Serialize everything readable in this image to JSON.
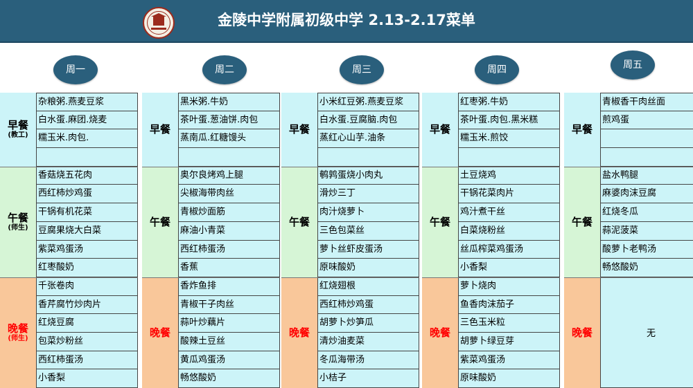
{
  "header": {
    "title": "金陵中学附属初级中学 2.13-2.17菜单"
  },
  "meals": {
    "breakfast": "早餐",
    "lunch": "午餐",
    "dinner": "晚餐",
    "breakfast_note": "(教工)",
    "lunch_note": "(师生)",
    "dinner_note": "(师生)"
  },
  "days": [
    {
      "name": "周一",
      "breakfast": [
        "杂粮粥.燕麦豆浆",
        "白水蛋.麻团.烧麦",
        "糯玉米.肉包.",
        ""
      ],
      "lunch": [
        "香菇烧五花肉",
        "西红柿炒鸡蛋",
        "干锅有机花菜",
        "豆腐果烧大白菜",
        "紫菜鸡蛋汤",
        "红枣酸奶"
      ],
      "dinner": [
        "千张卷肉",
        "香芹腐竹炒肉片",
        "红烧豆腐",
        "包菜炒粉丝",
        "西红柿蛋汤",
        "小香梨"
      ]
    },
    {
      "name": "周二",
      "breakfast": [
        "黑米粥.牛奶",
        "茶叶蛋.葱油饼.肉包",
        "蒸南瓜.红糖馒头",
        ""
      ],
      "lunch": [
        "奥尔良烤鸡上腿",
        "尖椒海带肉丝",
        "青椒炒面筋",
        "麻油小青菜",
        "西红柿蛋汤",
        "香蕉"
      ],
      "dinner": [
        "香炸鱼排",
        "青椒干子肉丝",
        "蒜叶炒藕片",
        "酸辣土豆丝",
        "黄瓜鸡蛋汤",
        "畅悠酸奶"
      ]
    },
    {
      "name": "周三",
      "breakfast": [
        "小米红豆粥.燕麦豆浆",
        "白水蛋.豆腐脑.肉包",
        "蒸红心山芋.油条",
        ""
      ],
      "lunch": [
        "鹌鹑蛋烧小肉丸",
        "滑炒三丁",
        "肉汁烧萝卜",
        "三色包菜丝",
        "萝卜丝虾皮蛋汤",
        "原味酸奶"
      ],
      "dinner": [
        "红烧翅根",
        "西红柿炒鸡蛋",
        "胡萝卜炒笋瓜",
        "清炒油麦菜",
        "冬瓜海带汤",
        "小桔子"
      ]
    },
    {
      "name": "周四",
      "breakfast": [
        "红枣粥.牛奶",
        "茶叶蛋.肉包.黑米糕",
        "糯玉米.煎饺",
        ""
      ],
      "lunch": [
        "土豆烧鸡",
        "干锅花菜肉片",
        "鸡汁煮干丝",
        "白菜烧粉丝",
        "丝瓜榨菜鸡蛋汤",
        "小香梨"
      ],
      "dinner": [
        "萝卜烧肉",
        "鱼香肉沫茄子",
        "三色玉米粒",
        "胡萝卜绿豆芽",
        "紫菜鸡蛋汤",
        "原味酸奶"
      ]
    },
    {
      "name": "周五",
      "breakfast": [
        "青椒香干肉丝面",
        "煎鸡蛋",
        "",
        ""
      ],
      "lunch": [
        "盐水鸭腿",
        "麻婆肉沫豆腐",
        "红烧冬瓜",
        "蒜泥菠菜",
        "酸萝卜老鸭汤",
        "畅悠酸奶"
      ],
      "dinner_text": "无"
    }
  ]
}
